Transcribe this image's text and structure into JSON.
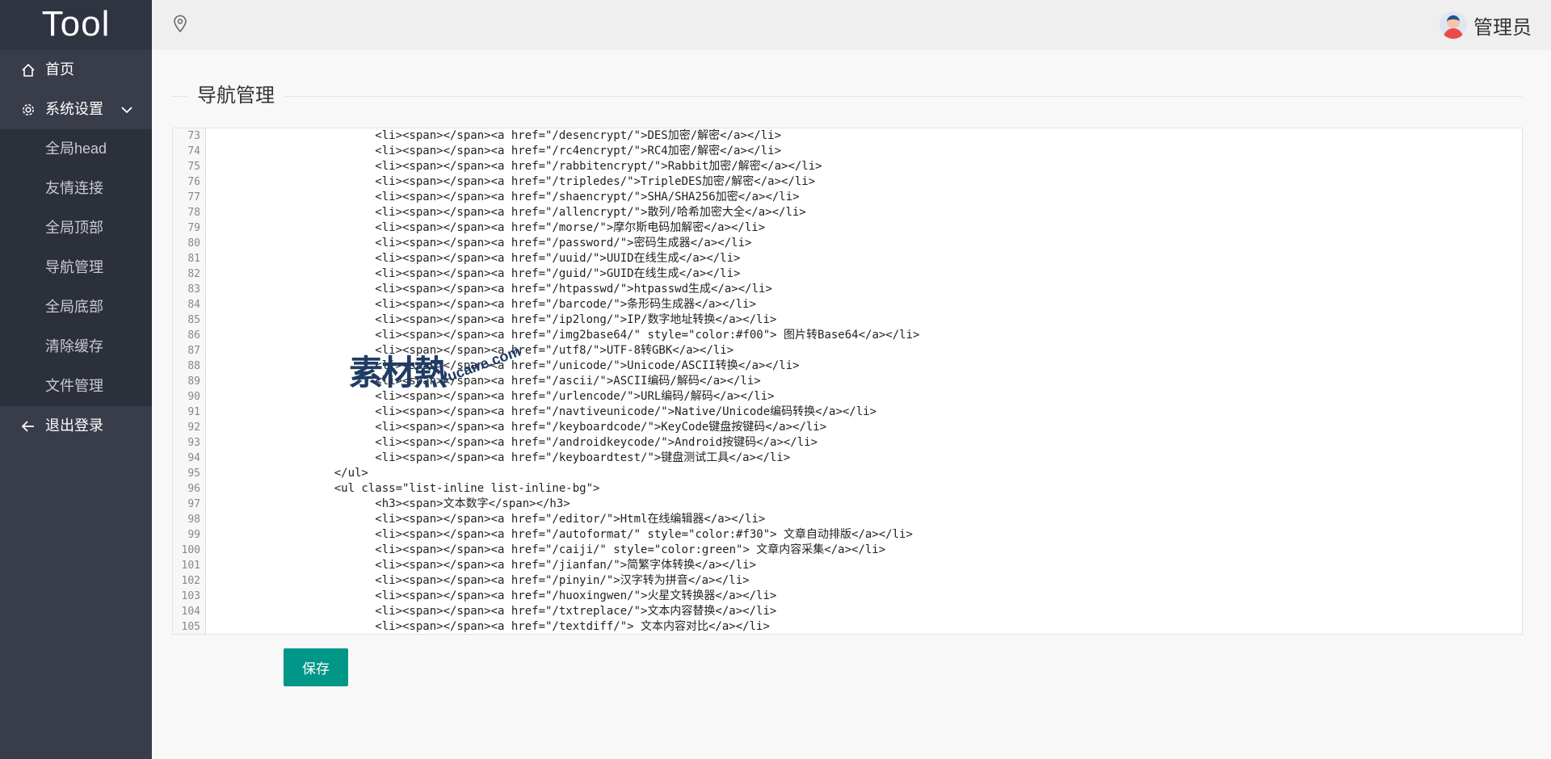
{
  "app": {
    "logo": "Tool"
  },
  "header": {
    "user_name": "管理员",
    "avatar_icon": "user-avatar-icon",
    "location_icon": "location-pin-icon"
  },
  "sidebar": {
    "items": [
      {
        "label": "首页",
        "icon": "home-icon"
      },
      {
        "label": "系统设置",
        "icon": "gear-icon",
        "expanded": true,
        "children": [
          "全局head",
          "友情连接",
          "全局顶部",
          "导航管理",
          "全局底部",
          "清除缓存",
          "文件管理"
        ]
      },
      {
        "label": "退出登录",
        "icon": "arrow-left-icon"
      }
    ]
  },
  "main": {
    "title": "导航管理",
    "save_label": "保存",
    "watermark": {
      "text": "素材熱",
      "domain": "sucaire.com"
    }
  },
  "editor": {
    "lines": [
      {
        "n": "73",
        "code": "                        <li><span></span><a href=\"/desencrypt/\">DES加密/解密</a></li>"
      },
      {
        "n": "74",
        "code": "                        <li><span></span><a href=\"/rc4encrypt/\">RC4加密/解密</a></li>"
      },
      {
        "n": "75",
        "code": "                        <li><span></span><a href=\"/rabbitencrypt/\">Rabbit加密/解密</a></li>"
      },
      {
        "n": "76",
        "code": "                        <li><span></span><a href=\"/tripledes/\">TripleDES加密/解密</a></li>"
      },
      {
        "n": "77",
        "code": "                        <li><span></span><a href=\"/shaencrypt/\">SHA/SHA256加密</a></li>"
      },
      {
        "n": "78",
        "code": "                        <li><span></span><a href=\"/allencrypt/\">散列/哈希加密大全</a></li>"
      },
      {
        "n": "79",
        "code": "                        <li><span></span><a href=\"/morse/\">摩尔斯电码加解密</a></li>"
      },
      {
        "n": "80",
        "code": "                        <li><span></span><a href=\"/password/\">密码生成器</a></li>"
      },
      {
        "n": "81",
        "code": "                        <li><span></span><a href=\"/uuid/\">UUID在线生成</a></li>"
      },
      {
        "n": "82",
        "code": "                        <li><span></span><a href=\"/guid/\">GUID在线生成</a></li>"
      },
      {
        "n": "83",
        "code": "                        <li><span></span><a href=\"/htpasswd/\">htpasswd生成</a></li>"
      },
      {
        "n": "84",
        "code": "                        <li><span></span><a href=\"/barcode/\">条形码生成器</a></li>"
      },
      {
        "n": "85",
        "code": "                        <li><span></span><a href=\"/ip2long/\">IP/数字地址转换</a></li>"
      },
      {
        "n": "86",
        "code": "                        <li><span></span><a href=\"/img2base64/\" style=\"color:#f00\"> 图片转Base64</a></li>"
      },
      {
        "n": "87",
        "code": "                        <li><span></span><a href=\"/utf8/\">UTF-8转GBK</a></li>"
      },
      {
        "n": "88",
        "code": "                        <li><span></span><a href=\"/unicode/\">Unicode/ASCII转换</a></li>"
      },
      {
        "n": "89",
        "code": "                        <li><span></span><a href=\"/ascii/\">ASCII编码/解码</a></li>"
      },
      {
        "n": "90",
        "code": "                        <li><span></span><a href=\"/urlencode/\">URL编码/解码</a></li>"
      },
      {
        "n": "91",
        "code": "                        <li><span></span><a href=\"/navtiveunicode/\">Native/Unicode编码转换</a></li>"
      },
      {
        "n": "92",
        "code": "                        <li><span></span><a href=\"/keyboardcode/\">KeyCode键盘按键码</a></li>"
      },
      {
        "n": "93",
        "code": "                        <li><span></span><a href=\"/androidkeycode/\">Android按键码</a></li>"
      },
      {
        "n": "94",
        "code": "                        <li><span></span><a href=\"/keyboardtest/\">键盘测试工具</a></li>"
      },
      {
        "n": "95",
        "code": "                  </ul>"
      },
      {
        "n": "96",
        "code": "                  <ul class=\"list-inline list-inline-bg\">"
      },
      {
        "n": "97",
        "code": "                        <h3><span>文本数字</span></h3>"
      },
      {
        "n": "98",
        "code": "                        <li><span></span><a href=\"/editor/\">Html在线编辑器</a></li>"
      },
      {
        "n": "99",
        "code": "                        <li><span></span><a href=\"/autoformat/\" style=\"color:#f30\"> 文章自动排版</a></li>"
      },
      {
        "n": "100",
        "code": "                        <li><span></span><a href=\"/caiji/\" style=\"color:green\"> 文章内容采集</a></li>"
      },
      {
        "n": "101",
        "code": "                        <li><span></span><a href=\"/jianfan/\">简繁字体转换</a></li>"
      },
      {
        "n": "102",
        "code": "                        <li><span></span><a href=\"/pinyin/\">汉字转为拼音</a></li>"
      },
      {
        "n": "103",
        "code": "                        <li><span></span><a href=\"/huoxingwen/\">火星文转换器</a></li>"
      },
      {
        "n": "104",
        "code": "                        <li><span></span><a href=\"/txtreplace/\">文本内容替换</a></li>"
      },
      {
        "n": "105",
        "code": "                        <li><span></span><a href=\"/textdiff/\"> 文本内容对比</a></li>"
      }
    ]
  }
}
